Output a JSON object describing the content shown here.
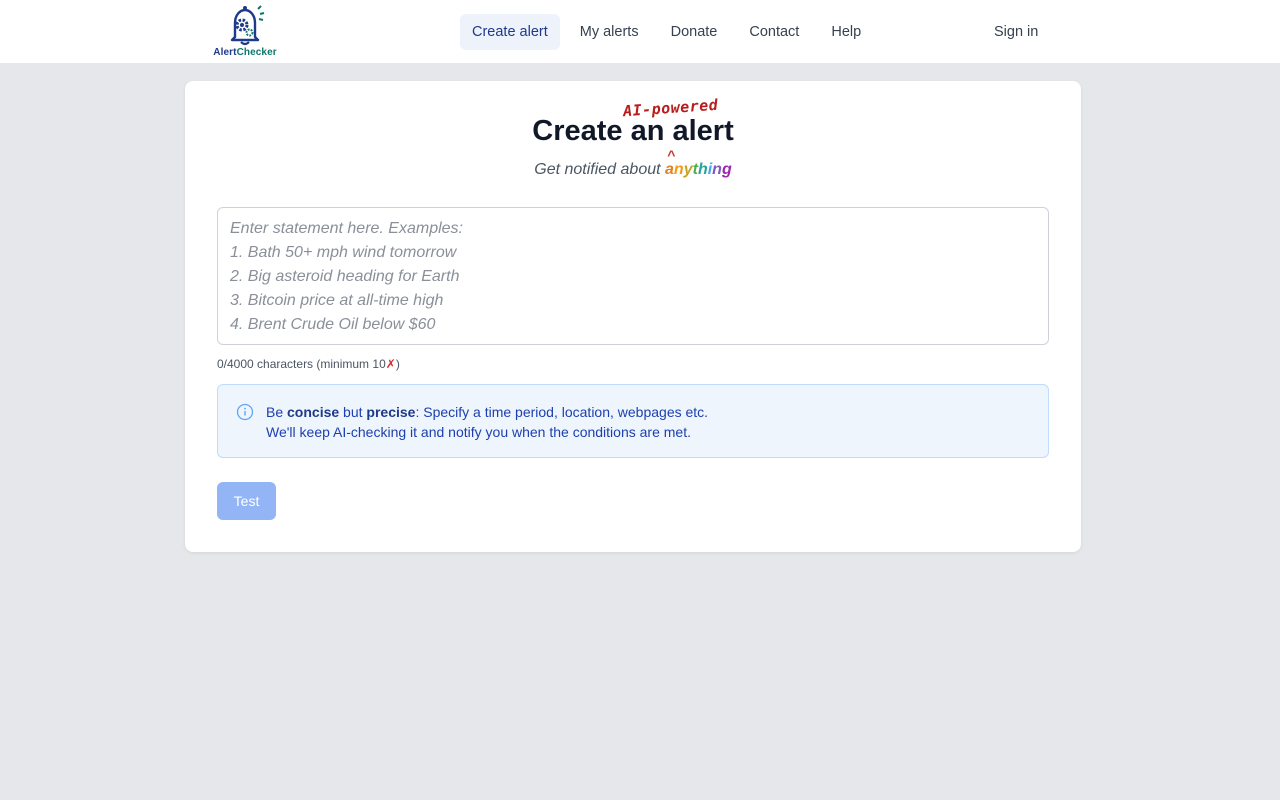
{
  "brand": {
    "name_part1": "Alert",
    "name_part2": "Checker"
  },
  "nav": {
    "items": [
      {
        "label": "Create alert",
        "active": true
      },
      {
        "label": "My alerts",
        "active": false
      },
      {
        "label": "Donate",
        "active": false
      },
      {
        "label": "Contact",
        "active": false
      },
      {
        "label": "Help",
        "active": false
      }
    ],
    "sign_in": "Sign in"
  },
  "hero": {
    "title": "Create an alert",
    "title_insert": "AI-powered",
    "caret": "^",
    "subtitle_prefix": "Get notified about ",
    "subtitle_highlight": "anything"
  },
  "statement": {
    "value": "",
    "placeholder_lines": [
      "Enter statement here. Examples:",
      "1. Bath 50+ mph wind tomorrow",
      "2. Big asteroid heading for Earth",
      "3. Bitcoin price at all-time high",
      "4. Brent Crude Oil below $60"
    ],
    "char_count": "0/4000 characters (minimum 10",
    "char_mark": "✗",
    "char_close": ")"
  },
  "info": {
    "line1_be": "Be ",
    "line1_concise": "concise",
    "line1_but": " but ",
    "line1_precise": "precise",
    "line1_rest": ": Specify a time period, location, webpages etc.",
    "line2": "We'll keep AI-checking it and notify you when the conditions are met."
  },
  "actions": {
    "test_label": "Test"
  },
  "colors": {
    "rainbow": [
      "#e67e22",
      "#f39c12",
      "#c9a227",
      "#4caf50",
      "#26a69a",
      "#42a5f5",
      "#7e57c2",
      "#9c27b0"
    ],
    "primary_disabled": "#93b4f5"
  }
}
